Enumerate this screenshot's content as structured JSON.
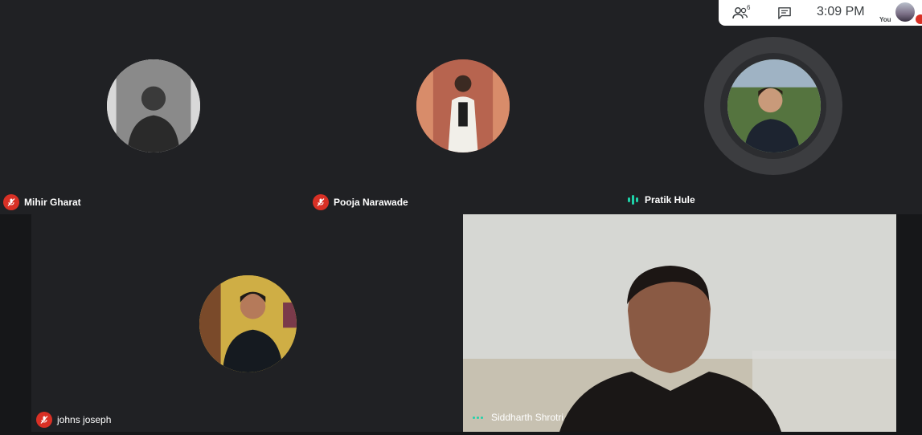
{
  "participants": [
    {
      "name": "Mihir Gharat",
      "muted": true,
      "speaking": false
    },
    {
      "name": "Pooja Narawade",
      "muted": true,
      "speaking": false
    },
    {
      "name": "Pratik Hule",
      "muted": false,
      "speaking": true
    },
    {
      "name": "johns joseph",
      "muted": true,
      "speaking": false
    },
    {
      "name": "Siddharth Shrotri",
      "muted": false,
      "speaking": false,
      "video_on": true
    }
  ],
  "topbar": {
    "people_count": "6",
    "time": "3:09 PM",
    "self_label": "You"
  },
  "colors": {
    "background": "#202124",
    "mute_red": "#d93025",
    "speaking_teal": "#1ed2a9"
  }
}
